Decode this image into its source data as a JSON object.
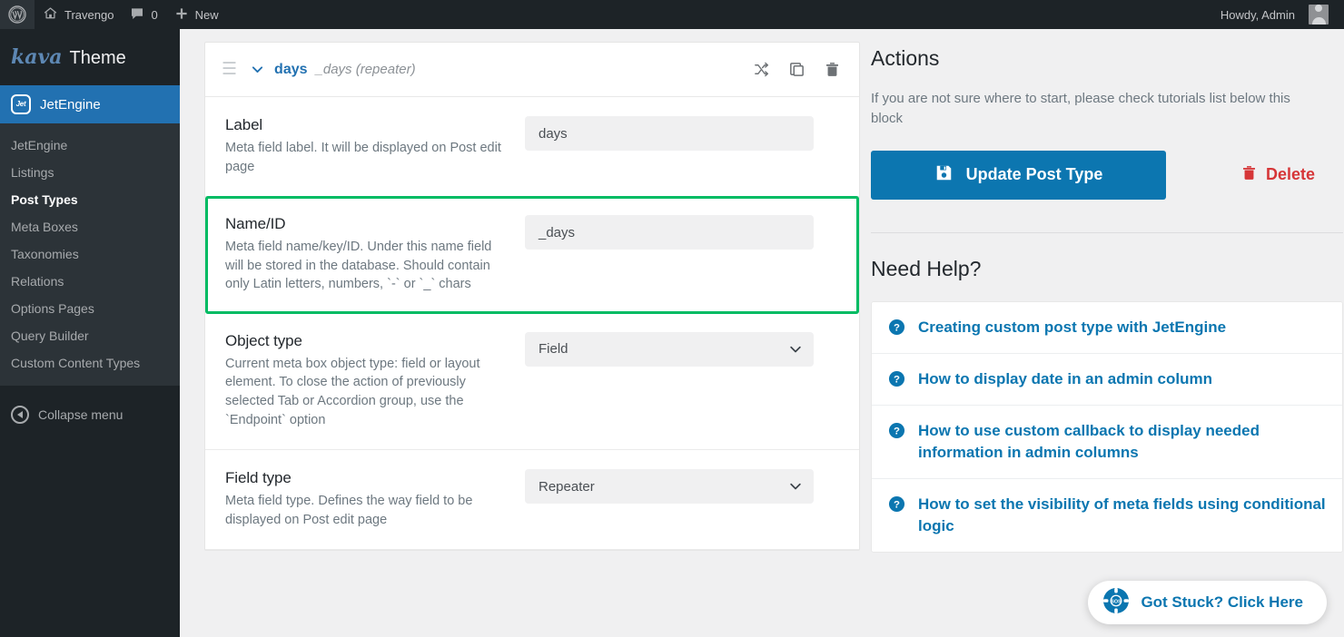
{
  "adminbar": {
    "wp_logo_icon": "wordpress-logo-icon",
    "home_icon": "home-icon",
    "site_name": "Travengo",
    "comments_icon": "comment-bubble-icon",
    "comments_count": "0",
    "new_icon": "plus-icon",
    "new_label": "New",
    "howdy": "Howdy, Admin",
    "avatar_icon": "user-avatar-icon"
  },
  "sidebar": {
    "brand": {
      "name": "kava",
      "suffix": "Theme"
    },
    "active_menu": {
      "label": "JetEngine",
      "icon": "jetengine-icon"
    },
    "items": [
      {
        "label": "JetEngine",
        "current": false
      },
      {
        "label": "Listings",
        "current": false
      },
      {
        "label": "Post Types",
        "current": true
      },
      {
        "label": "Meta Boxes",
        "current": false
      },
      {
        "label": "Taxonomies",
        "current": false
      },
      {
        "label": "Relations",
        "current": false
      },
      {
        "label": "Options Pages",
        "current": false
      },
      {
        "label": "Query Builder",
        "current": false
      },
      {
        "label": "Custom Content Types",
        "current": false
      }
    ],
    "collapse": {
      "label": "Collapse menu",
      "icon": "collapse-arrow-icon"
    }
  },
  "field_card": {
    "header": {
      "drag_icon": "drag-handle-icon",
      "toggle_icon": "chevron-down-icon",
      "title": "days",
      "subtitle": "_days (repeater)",
      "shuffle_icon": "shuffle-icon",
      "duplicate_icon": "duplicate-icon",
      "delete_icon": "trash-icon"
    },
    "rows": [
      {
        "label": "Label",
        "desc": "Meta field label. It will be displayed on Post edit page",
        "control": "text",
        "value": "days",
        "highlighted": false
      },
      {
        "label": "Name/ID",
        "desc": "Meta field name/key/ID. Under this name field will be stored in the database. Should contain only Latin letters, numbers, `-` or `_` chars",
        "control": "text",
        "value": "_days",
        "highlighted": true
      },
      {
        "label": "Object type",
        "desc": "Current meta box object type: field or layout element. To close the action of previously selected Tab or Accordion group, use the `Endpoint` option",
        "control": "select",
        "value": "Field",
        "highlighted": false
      },
      {
        "label": "Field type",
        "desc": "Meta field type. Defines the way field to be displayed on Post edit page",
        "control": "select",
        "value": "Repeater",
        "highlighted": false
      }
    ]
  },
  "actions": {
    "title": "Actions",
    "description": "If you are not sure where to start, please check tutorials list below this block",
    "update_button": {
      "label": "Update Post Type",
      "icon": "save-floppy-icon"
    },
    "delete_button": {
      "label": "Delete",
      "icon": "trash-icon"
    }
  },
  "help": {
    "title": "Need Help?",
    "items": [
      {
        "icon": "question-circle-icon",
        "label": "Creating custom post type with JetEngine"
      },
      {
        "icon": "question-circle-icon",
        "label": "How to display date in an admin column"
      },
      {
        "icon": "question-circle-icon",
        "label": "How to use custom callback to display needed information in admin columns"
      },
      {
        "icon": "question-circle-icon",
        "label": "How to set the visibility of meta fields using conditional logic"
      }
    ]
  },
  "support_widget": {
    "icon": "lifebuoy-sos-icon",
    "label": "Got Stuck? Click Here"
  },
  "colors": {
    "admin_dark": "#1d2327",
    "admin_submenu": "#2c3338",
    "accent_blue": "#2271b1",
    "link_blue": "#0b76b0",
    "highlight_green": "#00bb63",
    "danger_red": "#d63638",
    "page_bg": "#f0f0f1"
  }
}
